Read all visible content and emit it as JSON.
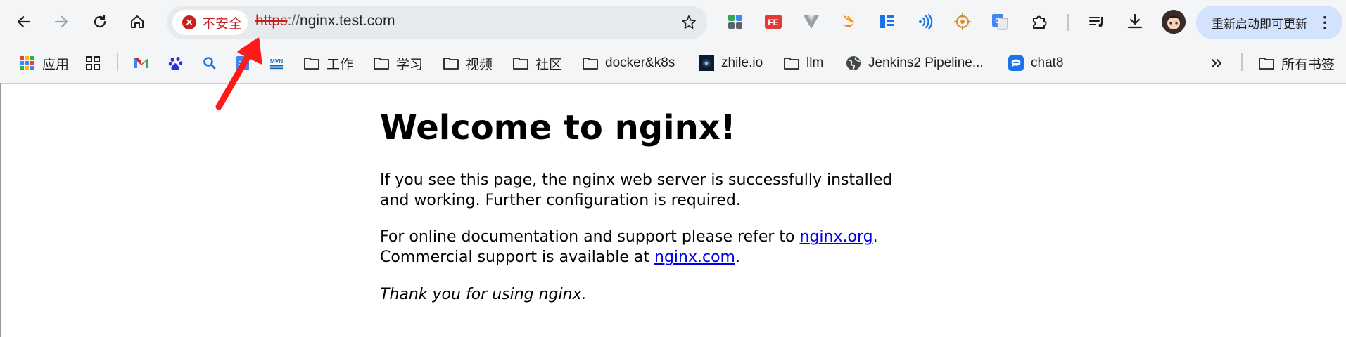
{
  "toolbar": {
    "security_chip": "不安全",
    "url_scheme": "https",
    "url_separator": "://",
    "url_host": "nginx.test.com",
    "update_button": "重新启动即可更新",
    "extension_icons": [
      "extensions-grid-icon",
      "fe-helper-icon",
      "vue-devtools-icon",
      "swift-icon",
      "reader-mode-icon",
      "wifi-signal-icon",
      "target-icon",
      "google-translate-icon",
      "puzzle-extensions-icon"
    ]
  },
  "bookmarks": {
    "apps": "应用",
    "work": "工作",
    "study": "学习",
    "video": "视频",
    "community": "社区",
    "docker": "docker&k8s",
    "zhile": "zhile.io",
    "llm": "llm",
    "jenkins": "Jenkins2 Pipeline...",
    "chat8": "chat8",
    "all_bookmarks": "所有书签"
  },
  "page": {
    "heading": "Welcome to nginx!",
    "p1": "If you see this page, the nginx web server is successfully installed and working. Further configuration is required.",
    "p2_prefix": "For online documentation and support please refer to ",
    "link_org": "nginx.org",
    "p2_mid": ".",
    "p2_commercial": "Commercial support is available at ",
    "link_com": "nginx.com",
    "p2_end": ".",
    "thanks": "Thank you for using nginx."
  },
  "colors": {
    "insecure": "#c5221f",
    "link": "#0000ee",
    "annotation_arrow": "#ff1a1a",
    "update_button_bg": "#d3e3fd"
  }
}
